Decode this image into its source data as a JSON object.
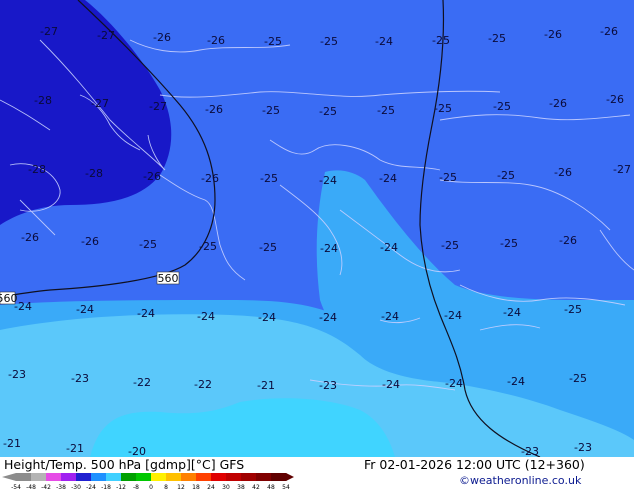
{
  "title": "Height/Temp. 500 hPa [gdmp][°C] GFS",
  "valid_time": "Fr 02-01-2026 12:00 UTC (12+360)",
  "credit": "©weatheronline.co.uk",
  "contour_labels": [
    "560",
    "560"
  ],
  "legend": {
    "ticks": [
      "-54",
      "-48",
      "-42",
      "-38",
      "-30",
      "-24",
      "-18",
      "-12",
      "-8",
      "0",
      "8",
      "12",
      "18",
      "24",
      "30",
      "38",
      "42",
      "48",
      "54"
    ],
    "colors": [
      "#8c8c8c",
      "#b4b4b4",
      "#e64be6",
      "#a020f0",
      "#2020d0",
      "#1e90ff",
      "#40d0ff",
      "#00a000",
      "#00c800",
      "#fff000",
      "#ffc000",
      "#ff8000",
      "#ff4000",
      "#e00000",
      "#c00000",
      "#a00000",
      "#800000",
      "#600000"
    ]
  },
  "temperatures": [
    "-27",
    "-27",
    "-26",
    "-26",
    "-25",
    "-25",
    "-24",
    "-25",
    "-25",
    "-26",
    "-26",
    "-28",
    "-27",
    "-27",
    "-26",
    "-25",
    "-25",
    "-25",
    "-25",
    "-25",
    "-26",
    "-26",
    "-28",
    "-28",
    "-26",
    "-26",
    "-25",
    "-24",
    "-24",
    "-25",
    "-25",
    "-26",
    "-27",
    "-26",
    "-26",
    "-25",
    "-25",
    "-25",
    "-24",
    "-24",
    "-25",
    "-25",
    "-26",
    "-24",
    "-24",
    "-24",
    "-24",
    "-24",
    "-24",
    "-24",
    "-24",
    "-24",
    "-25",
    "-23",
    "-23",
    "-22",
    "-22",
    "-21",
    "-23",
    "-24",
    "-24",
    "-24",
    "-25",
    "-21",
    "-21",
    "-20",
    "-23",
    "-23"
  ]
}
